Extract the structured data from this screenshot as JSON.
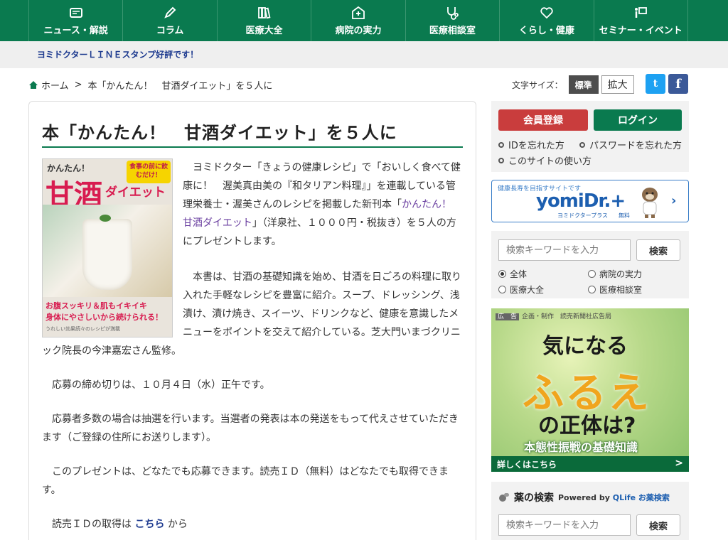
{
  "nav": {
    "items": [
      {
        "label": "ニュース・解説",
        "icon": "newspaper-icon"
      },
      {
        "label": "コラム",
        "icon": "pencil-icon"
      },
      {
        "label": "医療大全",
        "icon": "books-icon"
      },
      {
        "label": "病院の実力",
        "icon": "hospital-icon"
      },
      {
        "label": "医療相談室",
        "icon": "stethoscope-icon"
      },
      {
        "label": "くらし・健康",
        "icon": "heart-icon"
      },
      {
        "label": "セミナー・イベント",
        "icon": "presenter-icon"
      }
    ]
  },
  "promo": {
    "text": "ヨミドクターＬＩＮＥスタンプ好評です！"
  },
  "breadcrumb": {
    "home": "ホーム",
    "separator": ">",
    "current": "本「かんたん！　甘酒ダイエット」を５人に"
  },
  "font_size": {
    "label": "文字サイズ：",
    "standard": "標準",
    "large": "拡大"
  },
  "social": {
    "twitter": "t",
    "facebook": "f"
  },
  "article": {
    "title": "本「かんたん！　甘酒ダイエット」を５人に",
    "cover": {
      "top": "かんたん！",
      "title_main": "甘酒",
      "title_sub": "ダイエット",
      "badge": "食事の前に飲むだけ！",
      "bottom1": "お腹スッキリ＆肌もイキイキ",
      "bottom2": "身体にやさしいから続けられる！",
      "bottom3": "うれしい効果続々のレシピが満載"
    },
    "p1_a": "ヨミドクター「きょうの健康レシピ」で「おいしく食べて健康に！　渥美真由美の『和タリアン料理』」を連載している管理栄養士・渥美さんのレシピを掲載した新刊本「",
    "p1_link": "かんたん！　甘酒ダイエット",
    "p1_b": "」（洋泉社、１０００円・税抜き）を５人の方にプレゼントします。",
    "p2": "本書は、甘酒の基礎知識を始め、甘酒を日ごろの料理に取り入れた手軽なレシピを豊富に紹介。スープ、ドレッシング、浅漬け、漬け焼き、スイーツ、ドリンクなど、健康を意識したメニューをポイントを交えて紹介している。芝大門いまづクリニック院長の今津嘉宏さん監修。",
    "p3": "応募の締め切りは、１０月４日（水）正午です。",
    "p4": "応募者多数の場合は抽選を行います。当選者の発表は本の発送をもって代えさせていただきます（ご登録の住所にお送りします）。",
    "p5": "このプレゼントは、どなたでも応募できます。読売ＩＤ（無料）はどなたでも取得できます。",
    "p6_a": "読売ＩＤの取得は ",
    "p6_link": "こちら",
    "p6_b": " から"
  },
  "sidebar": {
    "register": "会員登録",
    "login": "ログイン",
    "links": [
      "IDを忘れた方",
      "パスワードを忘れた方",
      "このサイトの使い方"
    ],
    "yomidr": {
      "tag": "健康長寿を目指すサイトです",
      "logo": "yomiDr.+",
      "sub": "ヨミドクタープラス",
      "free": "無料"
    },
    "search": {
      "placeholder": "検索キーワードを入力",
      "button": "検索",
      "options": [
        "全体",
        "病院の実力",
        "医療大全",
        "医療相談室"
      ],
      "selected": "全体"
    },
    "ad": {
      "tag_label": "広　告",
      "tag_text": "企画・制作　読売新聞社広告局",
      "line1": "気になる",
      "line2": "ふるえ",
      "line3": "の正体は?",
      "line4": "本態性振戦の基礎知識",
      "cta": "詳しくはこちら"
    },
    "drug_search": {
      "title": "薬の検索",
      "powered_by": "Powered by",
      "provider": "QLife お薬検索",
      "placeholder": "検索キーワードを入力",
      "button": "検索"
    }
  },
  "colors": {
    "brand_green": "#0a7a4f",
    "register_red": "#c93d3d",
    "link_blue": "#1d3a8f"
  }
}
